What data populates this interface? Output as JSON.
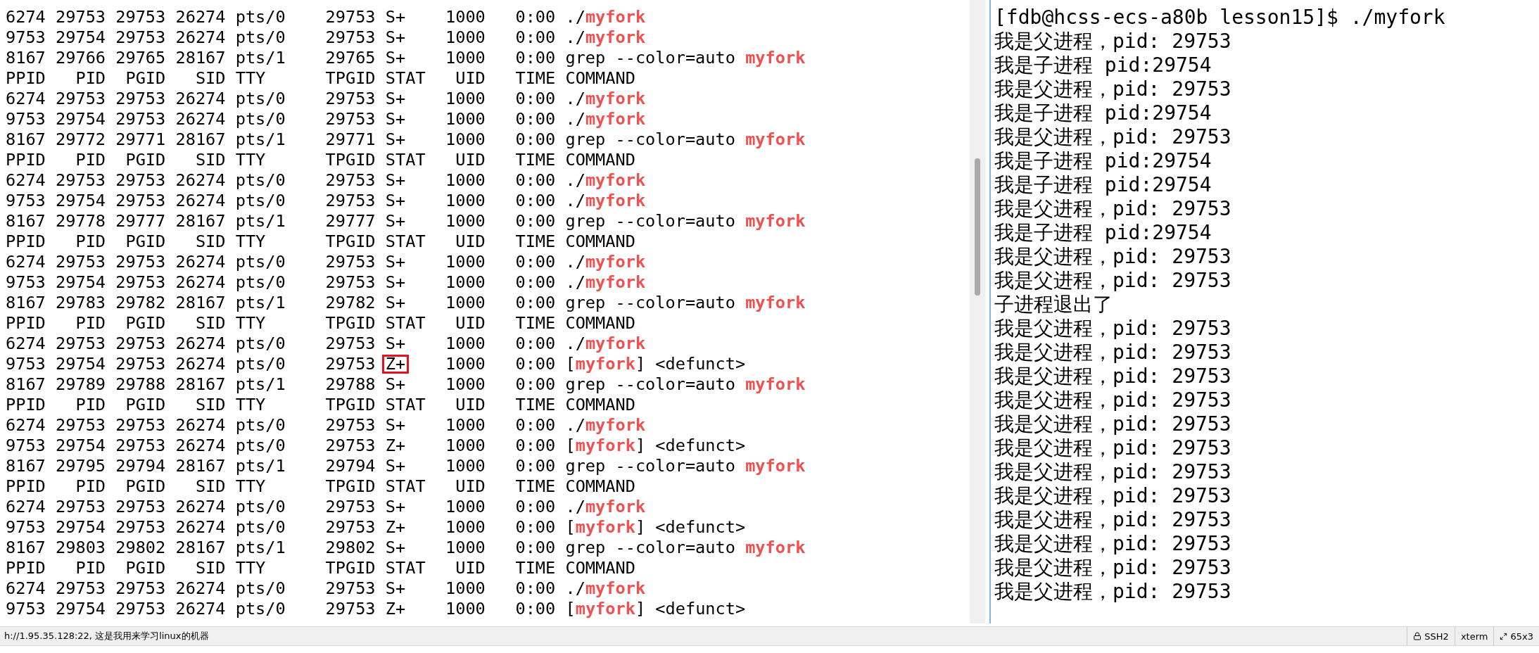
{
  "left_pane": {
    "lines": [
      {
        "kind": "plain",
        "text": "6274 29753 29753 26274 pts/0    29753 S+    1000   0:00 ./**myfork**"
      },
      {
        "kind": "plain",
        "text": "9753 29754 29753 26274 pts/0    29753 S+    1000   0:00 ./**myfork**"
      },
      {
        "kind": "plain",
        "text": "8167 29766 29765 28167 pts/1    29765 S+    1000   0:00 grep --color=auto **myfork**"
      },
      {
        "kind": "plain",
        "text": "PPID   PID  PGID   SID TTY      TPGID STAT   UID   TIME COMMAND"
      },
      {
        "kind": "plain",
        "text": "6274 29753 29753 26274 pts/0    29753 S+    1000   0:00 ./**myfork**"
      },
      {
        "kind": "plain",
        "text": "9753 29754 29753 26274 pts/0    29753 S+    1000   0:00 ./**myfork**"
      },
      {
        "kind": "plain",
        "text": "8167 29772 29771 28167 pts/1    29771 S+    1000   0:00 grep --color=auto **myfork**"
      },
      {
        "kind": "plain",
        "text": "PPID   PID  PGID   SID TTY      TPGID STAT   UID   TIME COMMAND"
      },
      {
        "kind": "plain",
        "text": "6274 29753 29753 26274 pts/0    29753 S+    1000   0:00 ./**myfork**"
      },
      {
        "kind": "plain",
        "text": "9753 29754 29753 26274 pts/0    29753 S+    1000   0:00 ./**myfork**"
      },
      {
        "kind": "plain",
        "text": "8167 29778 29777 28167 pts/1    29777 S+    1000   0:00 grep --color=auto **myfork**"
      },
      {
        "kind": "plain",
        "text": "PPID   PID  PGID   SID TTY      TPGID STAT   UID   TIME COMMAND"
      },
      {
        "kind": "plain",
        "text": "6274 29753 29753 26274 pts/0    29753 S+    1000   0:00 ./**myfork**"
      },
      {
        "kind": "plain",
        "text": "9753 29754 29753 26274 pts/0    29753 S+    1000   0:00 ./**myfork**"
      },
      {
        "kind": "plain",
        "text": "8167 29783 29782 28167 pts/1    29782 S+    1000   0:00 grep --color=auto **myfork**"
      },
      {
        "kind": "plain",
        "text": "PPID   PID  PGID   SID TTY      TPGID STAT   UID   TIME COMMAND"
      },
      {
        "kind": "plain",
        "text": "6274 29753 29753 26274 pts/0    29753 S+    1000   0:00 ./**myfork**"
      },
      {
        "kind": "annotated",
        "prefix": "9753 29754 29753 26274 pts/0    29753 ",
        "boxed": "Z+",
        "suffix": "    1000   0:00 [**myfork**] <defunct>"
      },
      {
        "kind": "plain",
        "text": "8167 29789 29788 28167 pts/1    29788 S+    1000   0:00 grep --color=auto **myfork**"
      },
      {
        "kind": "plain",
        "text": "PPID   PID  PGID   SID TTY      TPGID STAT   UID   TIME COMMAND"
      },
      {
        "kind": "plain",
        "text": "6274 29753 29753 26274 pts/0    29753 S+    1000   0:00 ./**myfork**"
      },
      {
        "kind": "plain",
        "text": "9753 29754 29753 26274 pts/0    29753 Z+    1000   0:00 [**myfork**] <defunct>"
      },
      {
        "kind": "plain",
        "text": "8167 29795 29794 28167 pts/1    29794 S+    1000   0:00 grep --color=auto **myfork**"
      },
      {
        "kind": "plain",
        "text": "PPID   PID  PGID   SID TTY      TPGID STAT   UID   TIME COMMAND"
      },
      {
        "kind": "plain",
        "text": "6274 29753 29753 26274 pts/0    29753 S+    1000   0:00 ./**myfork**"
      },
      {
        "kind": "plain",
        "text": "9753 29754 29753 26274 pts/0    29753 Z+    1000   0:00 [**myfork**] <defunct>"
      },
      {
        "kind": "plain",
        "text": "8167 29803 29802 28167 pts/1    29802 S+    1000   0:00 grep --color=auto **myfork**"
      },
      {
        "kind": "plain",
        "text": "PPID   PID  PGID   SID TTY      TPGID STAT   UID   TIME COMMAND"
      },
      {
        "kind": "plain",
        "text": "6274 29753 29753 26274 pts/0    29753 S+    1000   0:00 ./**myfork**"
      },
      {
        "kind": "plain",
        "text": "9753 29754 29753 26274 pts/0    29753 Z+    1000   0:00 [**myfork**] <defunct>"
      }
    ]
  },
  "right_pane": {
    "lines": [
      "[fdb@hcss-ecs-a80b lesson15]$ ./myfork",
      "我是父进程，pid: 29753",
      "我是子进程 pid:29754",
      "我是父进程，pid: 29753",
      "我是子进程 pid:29754",
      "我是父进程，pid: 29753",
      "我是子进程 pid:29754",
      "我是子进程 pid:29754",
      "我是父进程，pid: 29753",
      "我是子进程 pid:29754",
      "我是父进程，pid: 29753",
      "我是父进程，pid: 29753",
      "子进程退出了",
      "我是父进程，pid: 29753",
      "我是父进程，pid: 29753",
      "我是父进程，pid: 29753",
      "我是父进程，pid: 29753",
      "我是父进程，pid: 29753",
      "我是父进程，pid: 29753",
      "我是父进程，pid: 29753",
      "我是父进程，pid: 29753",
      "我是父进程，pid: 29753",
      "我是父进程，pid: 29753",
      "我是父进程，pid: 29753",
      "我是父进程，pid: 29753"
    ]
  },
  "status_bar": {
    "connection": "h://1.95.35.128:22, 这是我用来学习linux的机器",
    "protocol": "SSH2",
    "terminal": "xterm",
    "size": "65x3"
  }
}
